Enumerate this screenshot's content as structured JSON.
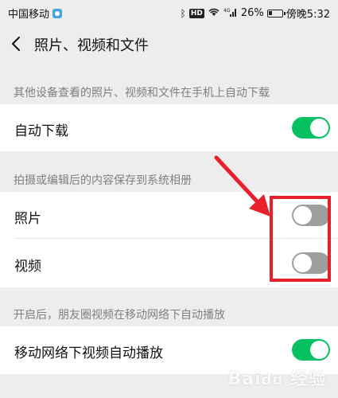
{
  "status_bar": {
    "carrier": "中国移动",
    "network": "4G",
    "hd": "HD",
    "battery_percent": "26%",
    "battery_level": 0.26,
    "time": "傍晚5:32"
  },
  "nav": {
    "title": "照片、视频和文件"
  },
  "sections": {
    "auto_download_header": "其他设备查看的照片、视频和文件在手机上自动下载",
    "auto_download_label": "自动下载",
    "auto_download_on": true,
    "save_header": "拍摄或编辑后的内容保存到系统相册",
    "photo_label": "照片",
    "photo_on": false,
    "video_label": "视频",
    "video_on": false,
    "moments_header": "开启后，朋友圈视频在移动网络下自动播放",
    "moments_label": "移动网络下视频自动播放",
    "moments_on": true
  },
  "annotation": {
    "highlight_color": "#e8202b"
  },
  "colors": {
    "toggle_on": "#07c160",
    "toggle_off": "#9e9e9e",
    "background": "#ededed"
  }
}
